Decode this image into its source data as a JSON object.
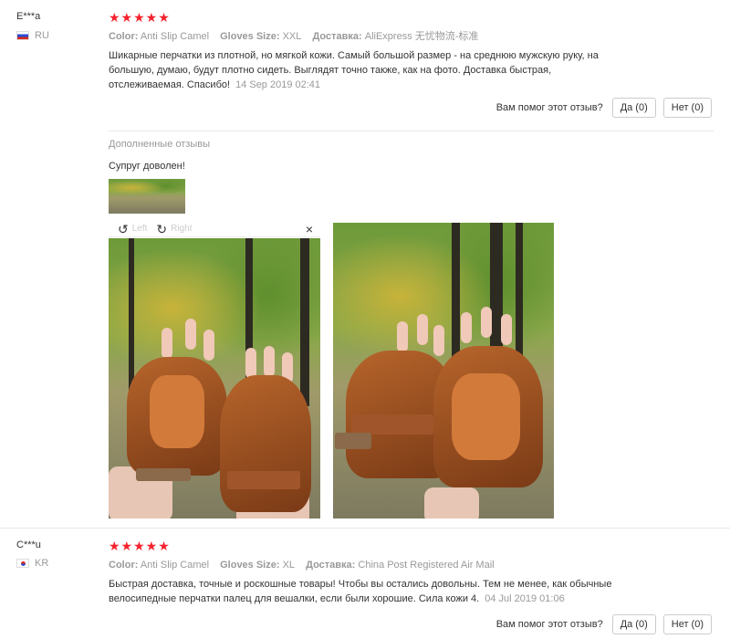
{
  "reviews": [
    {
      "author": "E***a",
      "country": "RU",
      "stars": "★★★★★",
      "attrs": {
        "color_label": "Color:",
        "color_value": "Anti Slip Camel",
        "size_label": "Gloves Size:",
        "size_value": "XXL",
        "delivery_label": "Доставка:",
        "delivery_value": "AliExpress 无忧物流-标准"
      },
      "text": "Шикарные перчатки из плотной, но мягкой кожи. Самый большой размер - на среднюю мужскую руку, на большую, думаю, будут плотно сидеть. Выглядят точно также, как на фото. Доставка быстрая, отслеживаемая. Спасибо!",
      "date": "14 Sep 2019 02:41",
      "helpful_label": "Вам помог этот отзыв?",
      "yes_label": "Да (0)",
      "no_label": "Нет (0)"
    },
    {
      "author": "C***u",
      "country": "KR",
      "stars": "★★★★★",
      "attrs": {
        "color_label": "Color:",
        "color_value": "Anti Slip Camel",
        "size_label": "Gloves Size:",
        "size_value": "XL",
        "delivery_label": "Доставка:",
        "delivery_value": "China Post Registered Air Mail"
      },
      "text": "Быстрая доставка, точные и роскошные товары! Чтобы вы остались довольны. Тем не менее, как обычные велосипедные перчатки палец для вешалки, если были хорошие. Сила кожи 4.",
      "date": "04 Jul 2019 01:06",
      "helpful_label": "Вам помог этот отзыв?",
      "yes_label": "Да (0)",
      "no_label": "Нет (0)"
    }
  ],
  "additional": {
    "title": "Дополненные отзывы",
    "text": "Супруг доволен!",
    "viewer": {
      "rotate_left": "Left",
      "rotate_right": "Right",
      "rotate_left_icon": "↺",
      "rotate_right_icon": "↻",
      "close_icon": "×"
    }
  },
  "colors": {
    "star": "#f5222d",
    "muted": "#999999",
    "active_thumb_border": "#f08c00"
  }
}
